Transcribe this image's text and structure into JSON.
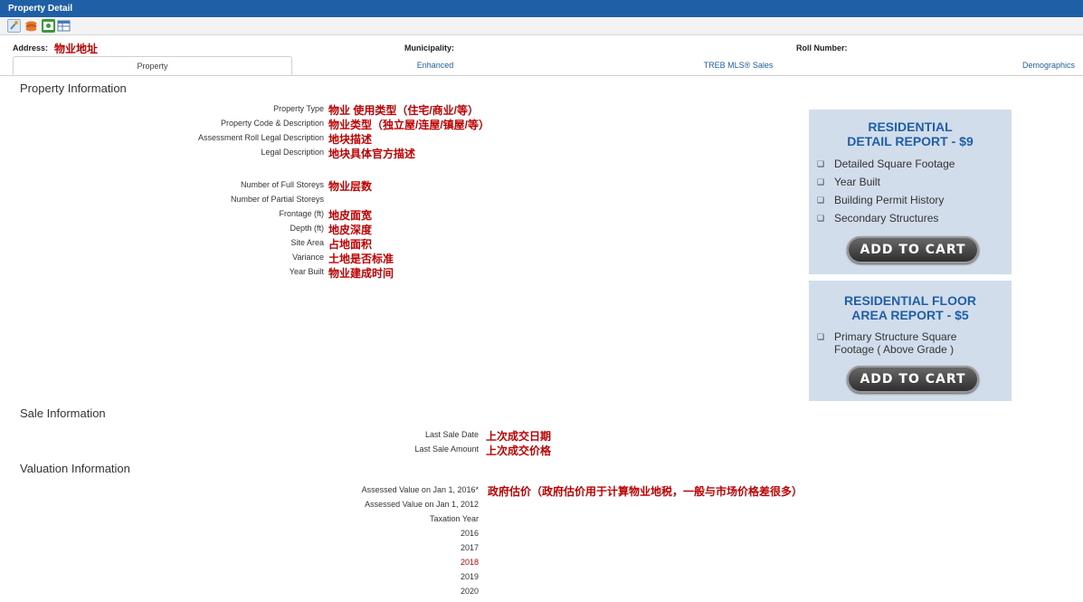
{
  "window": {
    "title": "Property Detail"
  },
  "toolbar": {
    "icons": [
      "pin-icon",
      "layers-icon",
      "photo-icon",
      "table-icon"
    ]
  },
  "header": {
    "address_label": "Address:",
    "address_value": "物业地址",
    "municipality_label": "Municipality:",
    "roll_label": "Roll Number:"
  },
  "tabs": [
    {
      "label": "Property"
    },
    {
      "label": "Enhanced"
    },
    {
      "label": "TREB MLS® Sales"
    },
    {
      "label": "Demographics"
    }
  ],
  "property": {
    "title": "Property Information",
    "rows": [
      {
        "label": "Property Type",
        "value": "物业 使用类型（住宅/商业/等）"
      },
      {
        "label": "Property Code & Description",
        "value": "物业类型（独立屋/连屋/镇屋/等）"
      },
      {
        "label": "Assessment Roll Legal Description",
        "value": "地块描述"
      },
      {
        "label": "Legal Description",
        "value": "地块具体官方描述"
      },
      {
        "label": "Number of Full Storeys",
        "value": "物业层数"
      },
      {
        "label": "Number of Partial Storeys",
        "value": ""
      },
      {
        "label": "Frontage (ft)",
        "value": "地皮面宽"
      },
      {
        "label": "Depth (ft)",
        "value": "地皮深度"
      },
      {
        "label": "Site Area",
        "value": "占地面积"
      },
      {
        "label": "Variance",
        "value": "土地是否标准"
      },
      {
        "label": "Year Built",
        "value": "物业建成时间"
      }
    ]
  },
  "sale": {
    "title": "Sale Information",
    "rows": [
      {
        "label": "Last Sale Date",
        "value": "上次成交日期"
      },
      {
        "label": "Last Sale Amount",
        "value": "上次成交价格"
      }
    ]
  },
  "valuation": {
    "title": "Valuation Information",
    "rows": [
      {
        "label": "Assessed Value on Jan 1, 2016*",
        "value": "政府估价（政府估价用于计算物业地税，一般与市场价格差很多）"
      },
      {
        "label": "Assessed Value on Jan 1, 2012",
        "value": ""
      },
      {
        "label": "Taxation Year",
        "value": ""
      }
    ],
    "years": [
      "2016",
      "2017",
      "2018",
      "2019",
      "2020"
    ],
    "highlight_year": "2018",
    "highlight_color": "#c00000"
  },
  "promos": [
    {
      "title_line1": "RESIDENTIAL",
      "title_line2": "DETAIL REPORT - $9",
      "items": [
        "Detailed Square Footage",
        "Year Built",
        "Building Permit History",
        "Secondary Structures"
      ],
      "button": "ADD TO CART"
    },
    {
      "title_line1": "RESIDENTIAL FLOOR",
      "title_line2": "AREA REPORT - $5",
      "items": [
        "Primary Structure Square",
        "Footage ( Above Grade )"
      ],
      "button": "ADD TO CART"
    }
  ],
  "colors": {
    "header_blue": "#1f5fa6",
    "value_red": "#c00000",
    "promo_bg": "#d2ddec"
  }
}
